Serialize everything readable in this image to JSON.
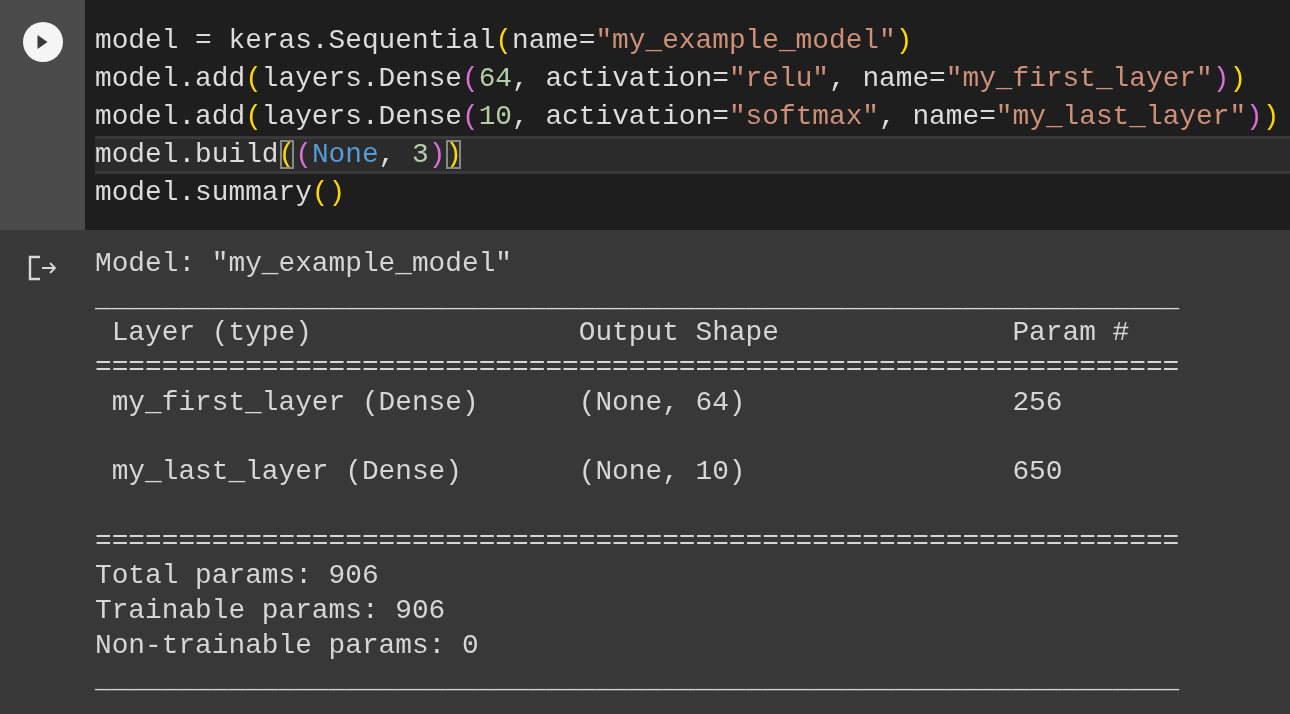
{
  "code_cell": {
    "lines": [
      {
        "active": false,
        "tokens": [
          {
            "kind": "plain",
            "text": "model = keras.Sequential"
          },
          {
            "kind": "bracket1",
            "text": "("
          },
          {
            "kind": "plain",
            "text": "name="
          },
          {
            "kind": "string",
            "text": "\"my_example_model\""
          },
          {
            "kind": "bracket1",
            "text": ")"
          }
        ]
      },
      {
        "active": false,
        "tokens": [
          {
            "kind": "plain",
            "text": "model.add"
          },
          {
            "kind": "bracket1",
            "text": "("
          },
          {
            "kind": "plain",
            "text": "layers.Dense"
          },
          {
            "kind": "bracket2",
            "text": "("
          },
          {
            "kind": "number",
            "text": "64"
          },
          {
            "kind": "plain",
            "text": ", activation="
          },
          {
            "kind": "string",
            "text": "\"relu\""
          },
          {
            "kind": "plain",
            "text": ", name="
          },
          {
            "kind": "string",
            "text": "\"my_first_layer\""
          },
          {
            "kind": "bracket2",
            "text": ")"
          },
          {
            "kind": "bracket1",
            "text": ")"
          }
        ]
      },
      {
        "active": false,
        "tokens": [
          {
            "kind": "plain",
            "text": "model.add"
          },
          {
            "kind": "bracket1",
            "text": "("
          },
          {
            "kind": "plain",
            "text": "layers.Dense"
          },
          {
            "kind": "bracket2",
            "text": "("
          },
          {
            "kind": "number",
            "text": "10"
          },
          {
            "kind": "plain",
            "text": ", activation="
          },
          {
            "kind": "string",
            "text": "\"softmax\""
          },
          {
            "kind": "plain",
            "text": ", name="
          },
          {
            "kind": "string",
            "text": "\"my_last_layer\""
          },
          {
            "kind": "bracket2",
            "text": ")"
          },
          {
            "kind": "bracket1",
            "text": ")"
          }
        ]
      },
      {
        "active": true,
        "tokens": [
          {
            "kind": "plain",
            "text": "model.build"
          },
          {
            "kind": "bracket1_match",
            "text": "("
          },
          {
            "kind": "bracket2",
            "text": "("
          },
          {
            "kind": "builtin",
            "text": "None"
          },
          {
            "kind": "plain",
            "text": ", "
          },
          {
            "kind": "number",
            "text": "3"
          },
          {
            "kind": "bracket2",
            "text": ")"
          },
          {
            "kind": "bracket1_match",
            "text": ")"
          }
        ]
      },
      {
        "active": false,
        "tokens": [
          {
            "kind": "plain",
            "text": "model.summary"
          },
          {
            "kind": "bracket1",
            "text": "()"
          }
        ]
      }
    ]
  },
  "output": {
    "title": "Model: \"my_example_model\"",
    "top_rule": "_________________________________________________________________",
    "columns": [
      "Layer (type)",
      "Output Shape",
      "Param #"
    ],
    "header_rule": "=================================================================",
    "rows": [
      [
        "my_first_layer (Dense)",
        "(None, 64)",
        "256"
      ],
      [
        "my_last_layer (Dense)",
        "(None, 10)",
        "650"
      ]
    ],
    "bottom_rule": "=================================================================",
    "totals": [
      "Total params: 906",
      "Trainable params: 906",
      "Non-trainable params: 0"
    ],
    "end_rule": "_________________________________________________________________"
  }
}
